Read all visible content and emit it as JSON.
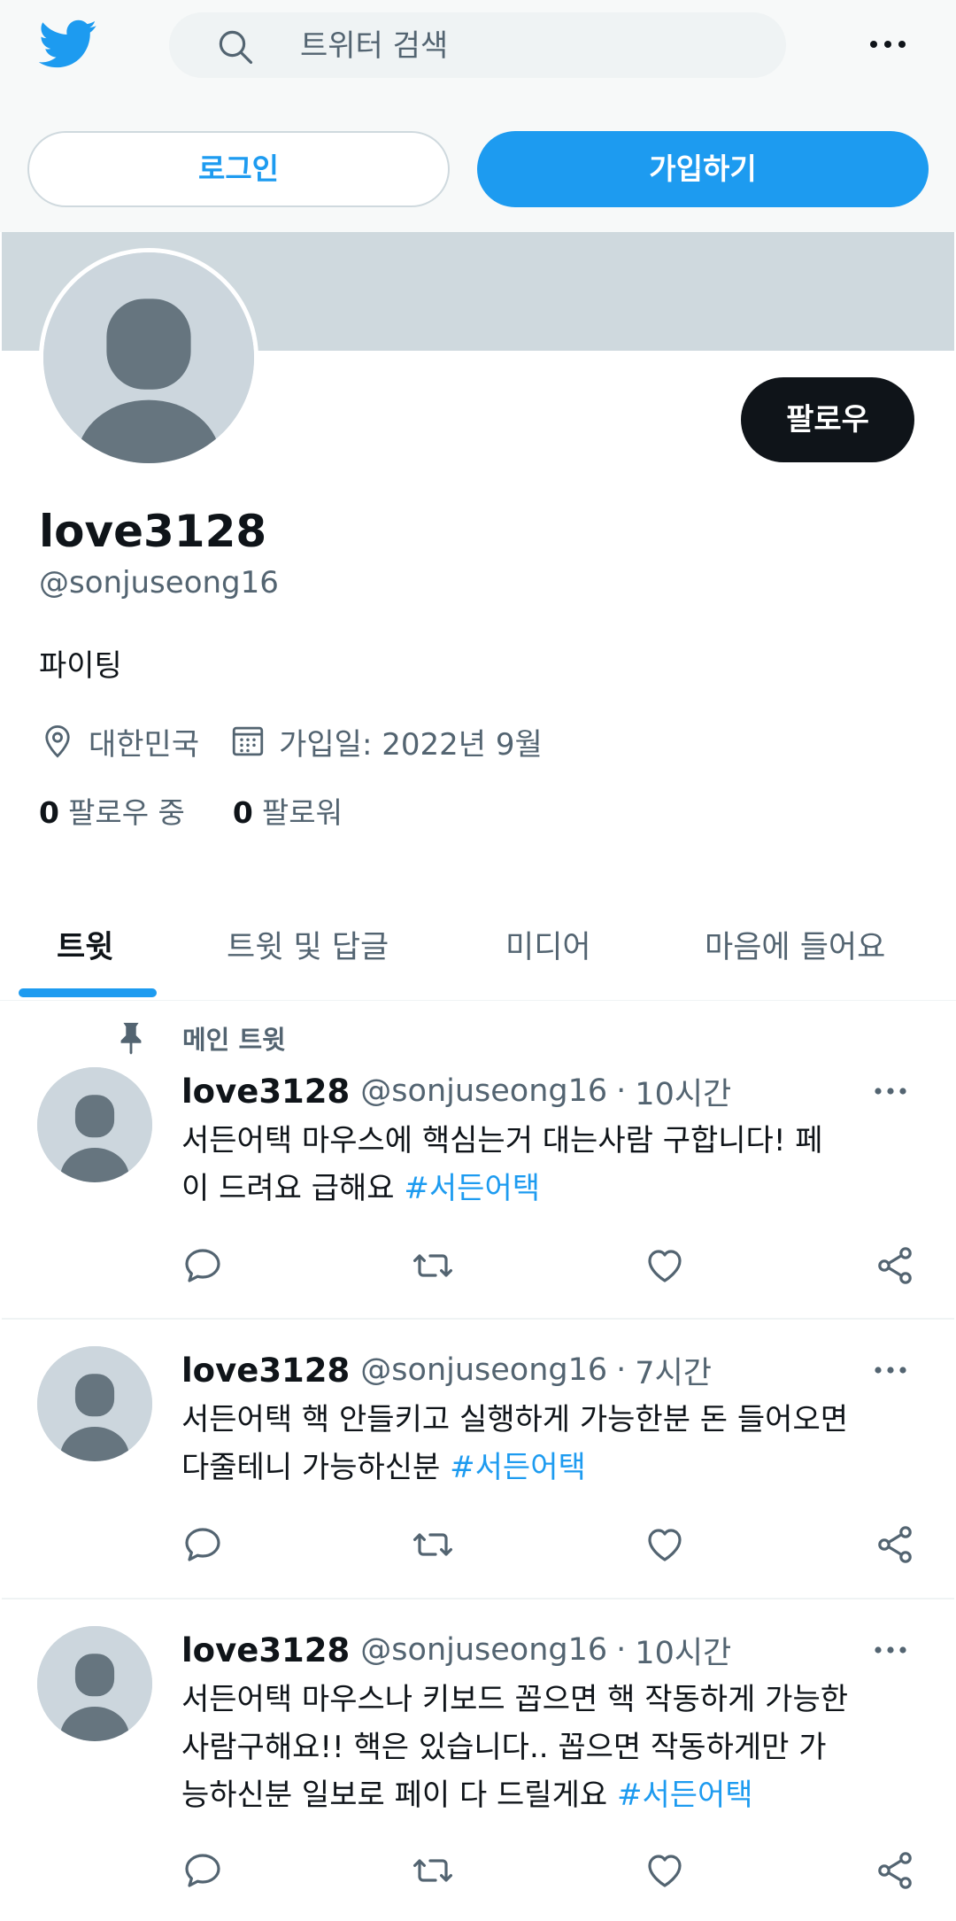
{
  "header": {
    "search_placeholder": "트위터 검색",
    "login_label": "로그인",
    "signup_label": "가입하기"
  },
  "profile": {
    "follow_label": "팔로우",
    "name": "love3128",
    "handle": "@sonjuseong16",
    "bio": "파이팅",
    "location": "대한민국",
    "joined": "가입일: 2022년 9월",
    "following_count": "0",
    "following_label": "팔로우 중",
    "followers_count": "0",
    "followers_label": "팔로워"
  },
  "tabs": [
    {
      "label": "트윗",
      "active": true
    },
    {
      "label": "트윗 및 답글",
      "active": false
    },
    {
      "label": "미디어",
      "active": false
    },
    {
      "label": "마음에 들어요",
      "active": false
    }
  ],
  "pinned_label": "메인 트윗",
  "tweets": [
    {
      "name": "love3128",
      "handle": "@sonjuseong16",
      "dot": "·",
      "time": "10시간",
      "text_lines": [
        "서든어택 마우스에 핵심는거 대는사람 구합니다! 페",
        "이 드려요 급해요"
      ],
      "hashtag": "#서든어택"
    },
    {
      "name": "love3128",
      "handle": "@sonjuseong16",
      "dot": "·",
      "time": "7시간",
      "text_lines": [
        "서든어택 핵 안들키고 실행하게 가능한분 돈 들어오면",
        "다줄테니 가능하신분"
      ],
      "hashtag": "#서든어택"
    },
    {
      "name": "love3128",
      "handle": "@sonjuseong16",
      "dot": "·",
      "time": "10시간",
      "text_lines": [
        "서든어택 마우스나 키보드 꼽으면 핵 작동하게 가능한",
        "사람구해요!! 핵은 있습니다.. 꼽으면 작동하게만 가",
        "능하신분 일보로 페이 다 드릴게요"
      ],
      "hashtag": "#서든어택"
    }
  ],
  "icons": {
    "logo": "twitter-bird-icon",
    "search": "search-icon",
    "more": "more-horizontal-icon",
    "location": "location-pin-icon",
    "calendar": "calendar-icon",
    "pin": "pin-icon",
    "reply": "reply-icon",
    "retweet": "retweet-icon",
    "like": "heart-icon",
    "share": "share-icon"
  },
  "colors": {
    "accent": "#1d9bf0",
    "text": "#0f1419",
    "secondary": "#536471",
    "banner": "#cfd9de"
  }
}
